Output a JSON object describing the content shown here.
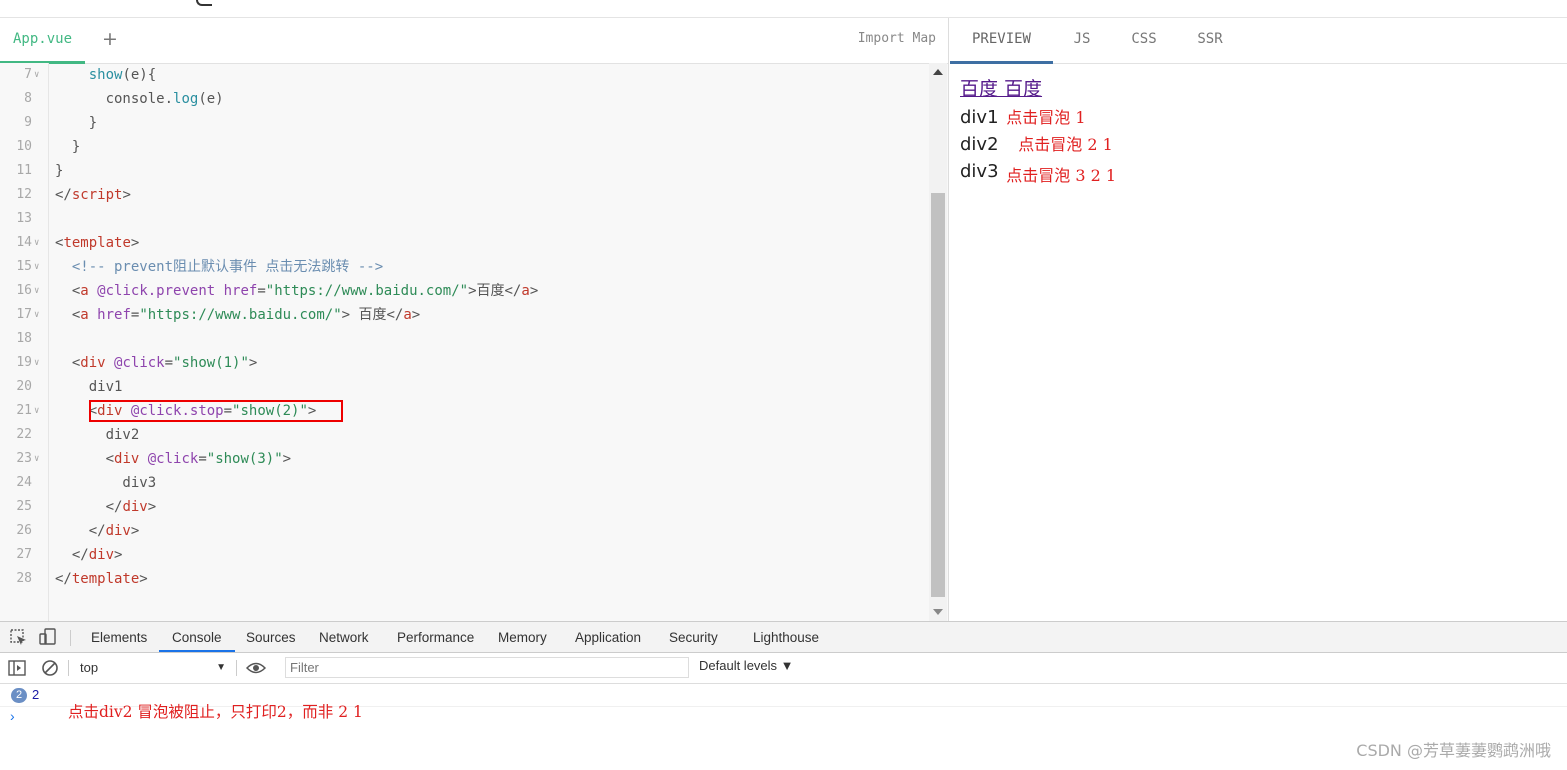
{
  "editor": {
    "file_tab": "App.vue",
    "add_tab": "+",
    "import_map": "Import Map",
    "lines": [
      {
        "n": "7",
        "fold": true,
        "seg": [
          [
            "    ",
            "p"
          ],
          [
            "show",
            "f"
          ],
          [
            "(e){",
            "p"
          ]
        ]
      },
      {
        "n": "8",
        "fold": false,
        "seg": [
          [
            "      console.",
            "p"
          ],
          [
            "log",
            "f"
          ],
          [
            "(e)",
            "p"
          ]
        ]
      },
      {
        "n": "9",
        "fold": false,
        "seg": [
          [
            "    }",
            "p"
          ]
        ]
      },
      {
        "n": "10",
        "fold": false,
        "seg": [
          [
            "  }",
            "p"
          ]
        ]
      },
      {
        "n": "11",
        "fold": false,
        "seg": [
          [
            "}",
            "p"
          ]
        ]
      },
      {
        "n": "12",
        "fold": false,
        "seg": [
          [
            "</",
            "p"
          ],
          [
            "script",
            "t"
          ],
          [
            ">",
            "p"
          ]
        ]
      },
      {
        "n": "13",
        "fold": false,
        "seg": []
      },
      {
        "n": "14",
        "fold": true,
        "seg": [
          [
            "<",
            "p"
          ],
          [
            "template",
            "t"
          ],
          [
            ">",
            "p"
          ]
        ]
      },
      {
        "n": "15",
        "fold": true,
        "seg": [
          [
            "  <!-- prevent阻止默认事件 点击无法跳转 -->",
            "c"
          ]
        ]
      },
      {
        "n": "16",
        "fold": true,
        "seg": [
          [
            "  <",
            "p"
          ],
          [
            "a",
            "t"
          ],
          [
            " ",
            "p"
          ],
          [
            "@click.prevent",
            "a"
          ],
          [
            " ",
            "p"
          ],
          [
            "href",
            "a"
          ],
          [
            "=",
            "p"
          ],
          [
            "\"https://www.baidu.com/\"",
            "s"
          ],
          [
            ">百度</",
            "p"
          ],
          [
            "a",
            "t"
          ],
          [
            ">",
            "p"
          ]
        ]
      },
      {
        "n": "17",
        "fold": true,
        "seg": [
          [
            "  <",
            "p"
          ],
          [
            "a",
            "t"
          ],
          [
            " ",
            "p"
          ],
          [
            "href",
            "a"
          ],
          [
            "=",
            "p"
          ],
          [
            "\"https://www.baidu.com/\"",
            "s"
          ],
          [
            "> 百度</",
            "p"
          ],
          [
            "a",
            "t"
          ],
          [
            ">",
            "p"
          ]
        ]
      },
      {
        "n": "18",
        "fold": false,
        "seg": []
      },
      {
        "n": "19",
        "fold": true,
        "seg": [
          [
            "  <",
            "p"
          ],
          [
            "div",
            "t"
          ],
          [
            " ",
            "p"
          ],
          [
            "@click",
            "a"
          ],
          [
            "=",
            "p"
          ],
          [
            "\"show(1)\"",
            "s"
          ],
          [
            ">",
            "p"
          ]
        ]
      },
      {
        "n": "20",
        "fold": false,
        "seg": [
          [
            "    div1",
            "p"
          ]
        ]
      },
      {
        "n": "21",
        "fold": true,
        "seg": [
          [
            "    <",
            "p"
          ],
          [
            "div",
            "t"
          ],
          [
            " ",
            "p"
          ],
          [
            "@click.stop",
            "a"
          ],
          [
            "=",
            "p"
          ],
          [
            "\"show(2)\"",
            "s"
          ],
          [
            ">",
            "p"
          ]
        ]
      },
      {
        "n": "22",
        "fold": false,
        "seg": [
          [
            "      div2",
            "p"
          ]
        ]
      },
      {
        "n": "23",
        "fold": true,
        "seg": [
          [
            "      <",
            "p"
          ],
          [
            "div",
            "t"
          ],
          [
            " ",
            "p"
          ],
          [
            "@click",
            "a"
          ],
          [
            "=",
            "p"
          ],
          [
            "\"show(3)\"",
            "s"
          ],
          [
            ">",
            "p"
          ]
        ]
      },
      {
        "n": "24",
        "fold": false,
        "seg": [
          [
            "        div3",
            "p"
          ]
        ]
      },
      {
        "n": "25",
        "fold": false,
        "seg": [
          [
            "      </",
            "p"
          ],
          [
            "div",
            "t"
          ],
          [
            ">",
            "p"
          ]
        ]
      },
      {
        "n": "26",
        "fold": false,
        "seg": [
          [
            "    </",
            "p"
          ],
          [
            "div",
            "t"
          ],
          [
            ">",
            "p"
          ]
        ]
      },
      {
        "n": "27",
        "fold": false,
        "seg": [
          [
            "  </",
            "p"
          ],
          [
            "div",
            "t"
          ],
          [
            ">",
            "p"
          ]
        ]
      },
      {
        "n": "28",
        "fold": false,
        "seg": [
          [
            "</",
            "p"
          ],
          [
            "template",
            "t"
          ],
          [
            ">",
            "p"
          ]
        ]
      }
    ]
  },
  "preview": {
    "tabs": [
      "PREVIEW",
      "JS",
      "CSS",
      "SSR"
    ],
    "links": "百度 百度",
    "rows": [
      {
        "label": "div1",
        "note": "点击冒泡 1"
      },
      {
        "label": "div2",
        "note": "点击冒泡 2 1"
      },
      {
        "label": "div3",
        "note": "点击冒泡 3 2 1"
      }
    ]
  },
  "devtools": {
    "tabs": [
      "Elements",
      "Console",
      "Sources",
      "Network",
      "Performance",
      "Memory",
      "Application",
      "Security",
      "Lighthouse"
    ],
    "context": "top",
    "filter_placeholder": "Filter",
    "levels": "Default levels ▼",
    "badge_count": "2",
    "log_value": "2",
    "prompt": "›",
    "annotation": "点击div2 冒泡被阻止，只打印2，而非 2 1"
  },
  "watermark": "CSDN @芳草萋萋鹦鹉洲哦",
  "colors": {
    "vue_green": "#42b883",
    "annotation_red": "#e02020",
    "highlight_box": "#ee0000"
  }
}
